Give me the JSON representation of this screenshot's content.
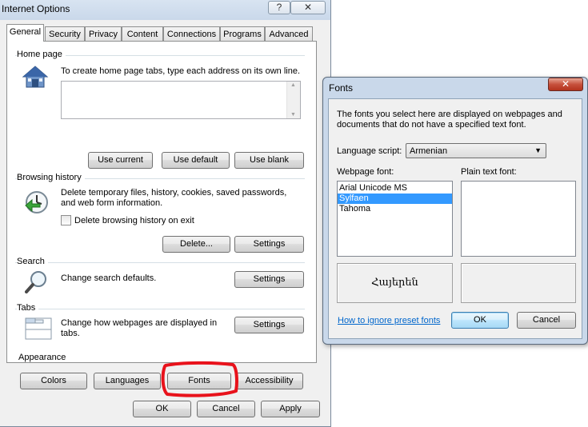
{
  "io": {
    "title": "Internet Options",
    "help_glyph": "?",
    "close_glyph": "✕",
    "tabs": [
      {
        "label": "General"
      },
      {
        "label": "Security"
      },
      {
        "label": "Privacy"
      },
      {
        "label": "Content"
      },
      {
        "label": "Connections"
      },
      {
        "label": "Programs"
      },
      {
        "label": "Advanced"
      }
    ],
    "homepage": {
      "group": "Home page",
      "desc": "To create home page tabs, type each address on its own line.",
      "value": "",
      "use_current": "Use current",
      "use_default": "Use default",
      "use_blank": "Use blank"
    },
    "history": {
      "group": "Browsing history",
      "desc": "Delete temporary files, history, cookies, saved passwords, and web form information.",
      "checkbox_label": "Delete browsing history on exit",
      "checkbox_checked": false,
      "delete": "Delete...",
      "settings": "Settings"
    },
    "search": {
      "group": "Search",
      "desc": "Change search defaults.",
      "settings": "Settings"
    },
    "tabsgroup": {
      "group": "Tabs",
      "desc": "Change how webpages are displayed in tabs.",
      "settings": "Settings"
    },
    "appearance": {
      "group": "Appearance",
      "colors": "Colors",
      "languages": "Languages",
      "fonts": "Fonts",
      "accessibility": "Accessibility",
      "highlight_color": "#e8121b"
    },
    "footer": {
      "ok": "OK",
      "cancel": "Cancel",
      "apply": "Apply"
    }
  },
  "fonts": {
    "title": "Fonts",
    "close_glyph": "✕",
    "desc": "The fonts you select here are displayed on webpages and documents that do not have a specified text font.",
    "language_label": "Language script:",
    "language_value": "Armenian",
    "webpage_label": "Webpage font:",
    "plain_label": "Plain text font:",
    "webpage_fonts": [
      {
        "name": "Arial Unicode MS",
        "selected": false
      },
      {
        "name": "Sylfaen",
        "selected": true
      },
      {
        "name": "Tahoma",
        "selected": false
      }
    ],
    "plain_fonts": [],
    "preview_text": "Հայերեն",
    "ignore_link": "How to ignore preset fonts",
    "ok": "OK",
    "cancel": "Cancel"
  }
}
